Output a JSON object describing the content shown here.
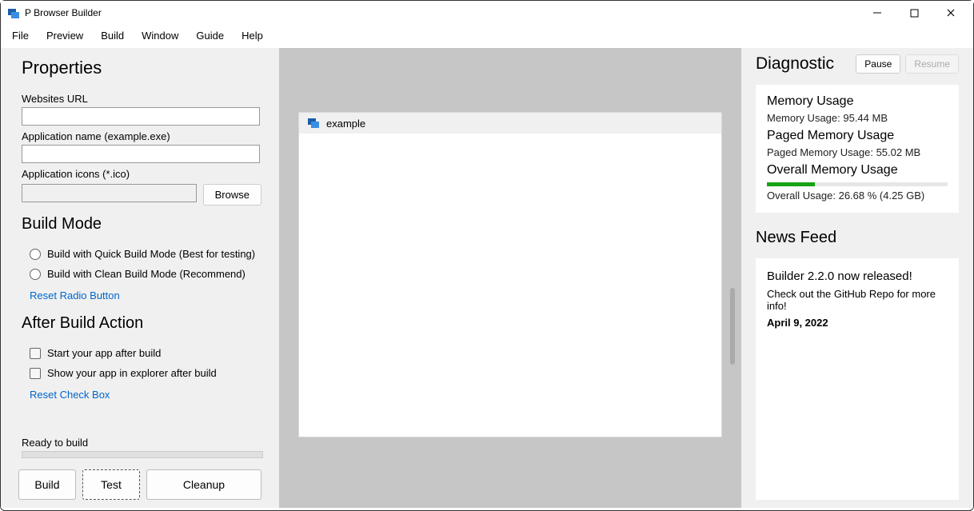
{
  "window": {
    "title": "P Browser Builder"
  },
  "menu": {
    "items": [
      "File",
      "Preview",
      "Build",
      "Window",
      "Guide",
      "Help"
    ]
  },
  "properties": {
    "heading": "Properties",
    "url_label": "Websites URL",
    "url_value": "",
    "appname_label": "Application name (example.exe)",
    "appname_value": "",
    "icons_label": "Application icons (*.ico)",
    "icons_value": "",
    "browse_label": "Browse"
  },
  "build_mode": {
    "heading": "Build Mode",
    "quick_label": "Build with Quick Build Mode (Best for testing)",
    "clean_label": "Build with Clean Build Mode (Recommend)",
    "reset_radio": "Reset Radio Button"
  },
  "after_build": {
    "heading": "After Build Action",
    "start_label": "Start your app after build",
    "show_label": "Show your app in explorer after build",
    "reset_check": "Reset Check Box"
  },
  "status": {
    "text": "Ready to build"
  },
  "actions": {
    "build": "Build",
    "test": "Test",
    "cleanup": "Cleanup"
  },
  "preview": {
    "tab_title": "example"
  },
  "diagnostic": {
    "heading": "Diagnostic",
    "pause": "Pause",
    "resume": "Resume",
    "mem_h": "Memory Usage",
    "mem_text": "Memory Usage: 95.44 MB",
    "paged_h": "Paged Memory Usage",
    "paged_text": "Paged Memory Usage: 55.02 MB",
    "overall_h": "Overall Memory Usage",
    "overall_text": "Overall Usage: 26.68 % (4.25 GB)"
  },
  "news": {
    "heading": "News Feed",
    "title": "Builder 2.2.0 now released!",
    "body": "Check out the GitHub Repo for more info!",
    "date": "April 9, 2022"
  }
}
